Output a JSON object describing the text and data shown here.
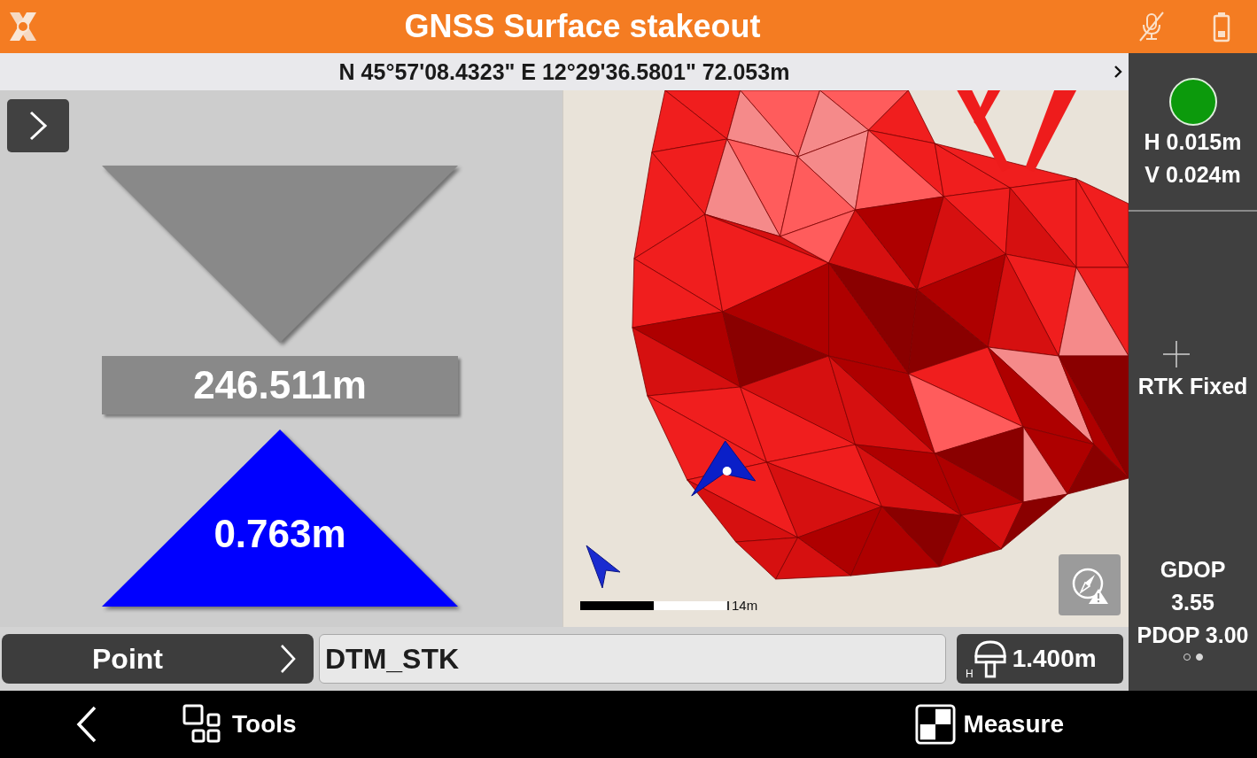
{
  "app_bar": {
    "title": "GNSS Surface stakeout"
  },
  "position_bar": {
    "coordinates": "N 45°57'08.4323\" E 12°29'36.5801\" 72.053m"
  },
  "stakeout": {
    "indicators": [
      {
        "kind": "down",
        "active": false
      },
      {
        "kind": "up",
        "active": true
      }
    ],
    "distance": "246.511m",
    "height_difference": "0.763m"
  },
  "map": {
    "scale_label": "14m"
  },
  "target": {
    "button_label": "Point",
    "point_name": "DTM_STK",
    "height_mark": "H",
    "antenna_height": "1.400m"
  },
  "gnss_panel": {
    "status_dot": {
      "color": "#0c9a0c"
    },
    "precision_h": "H 0.015m",
    "precision_v": "V 0.024m",
    "solution": "RTK Fixed",
    "gdop_label": "GDOP",
    "gdop_value": "3.55",
    "pdop": "PDOP 3.00",
    "pages": [
      {
        "selected": false
      },
      {
        "selected": true
      }
    ]
  },
  "nav_bar": {
    "items": [
      {
        "kind": "tools",
        "label": "Tools"
      },
      {
        "kind": "measure",
        "label": "Measure"
      }
    ]
  }
}
